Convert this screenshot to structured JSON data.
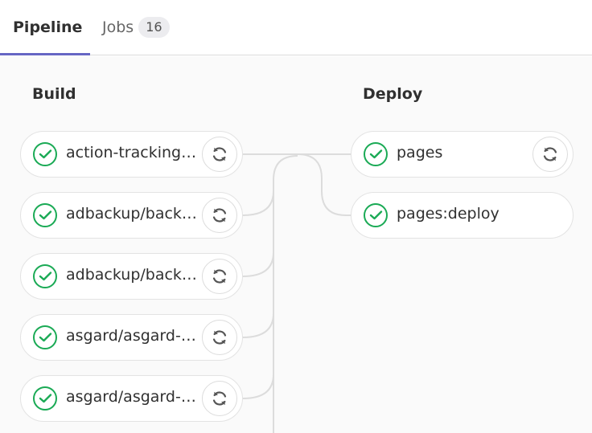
{
  "tabs": {
    "pipeline_label": "Pipeline",
    "jobs_label": "Jobs",
    "jobs_count": "16"
  },
  "stages": {
    "build": {
      "title": "Build",
      "jobs": [
        {
          "name": "action-tracking…",
          "status": "success",
          "action_icon": "retry-icon"
        },
        {
          "name": "adbackup/back…",
          "status": "success",
          "action_icon": "retry-icon"
        },
        {
          "name": "adbackup/back…",
          "status": "success",
          "action_icon": "retry-icon"
        },
        {
          "name": "asgard/asgard-…",
          "status": "success",
          "action_icon": "retry-icon"
        },
        {
          "name": "asgard/asgard-…",
          "status": "success",
          "action_icon": "retry-icon"
        }
      ]
    },
    "deploy": {
      "title": "Deploy",
      "jobs": [
        {
          "name": "pages",
          "status": "success",
          "action_icon": "retry-icon"
        },
        {
          "name": "pages:deploy",
          "status": "success"
        }
      ]
    }
  },
  "colors": {
    "success": "#1aaa55",
    "active_tab_underline": "#6666c4",
    "border": "#e3e3e3",
    "canvas_bg": "#fafafa"
  }
}
